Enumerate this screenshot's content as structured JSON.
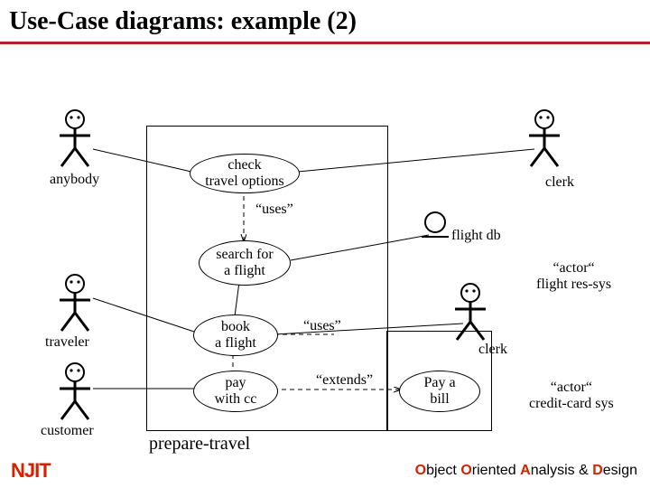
{
  "title": "Use-Case diagrams: example (2)",
  "actors": {
    "anybody": "anybody",
    "traveler": "traveler",
    "customer": "customer",
    "clerk1": "clerk",
    "clerk2": "clerk",
    "flightdb": "flight db"
  },
  "usecases": {
    "check": {
      "l1": "check",
      "l2": "travel options"
    },
    "search": {
      "l1": "search for",
      "l2": "a flight"
    },
    "book": {
      "l1": "book",
      "l2": "a flight"
    },
    "pay": {
      "l1": "pay",
      "l2": "with cc"
    },
    "bill": {
      "l1": "Pay a",
      "l2": "bill"
    }
  },
  "relations": {
    "uses1": "“uses”",
    "uses2": "“uses”",
    "extends": "“extends”"
  },
  "notes": {
    "actor_flight": {
      "l1": "“actor“",
      "l2": "flight res-sys"
    },
    "actor_cc": {
      "l1": "“actor“",
      "l2": "credit-card sys"
    }
  },
  "system_label": "prepare-travel",
  "footer": {
    "logo": "NJIT",
    "course": {
      "o1": "O",
      "t1": "bject ",
      "o2": "O",
      "t2": "riented ",
      "a": "A",
      "t3": "nalysis & ",
      "d": "D",
      "t4": "esign"
    }
  }
}
